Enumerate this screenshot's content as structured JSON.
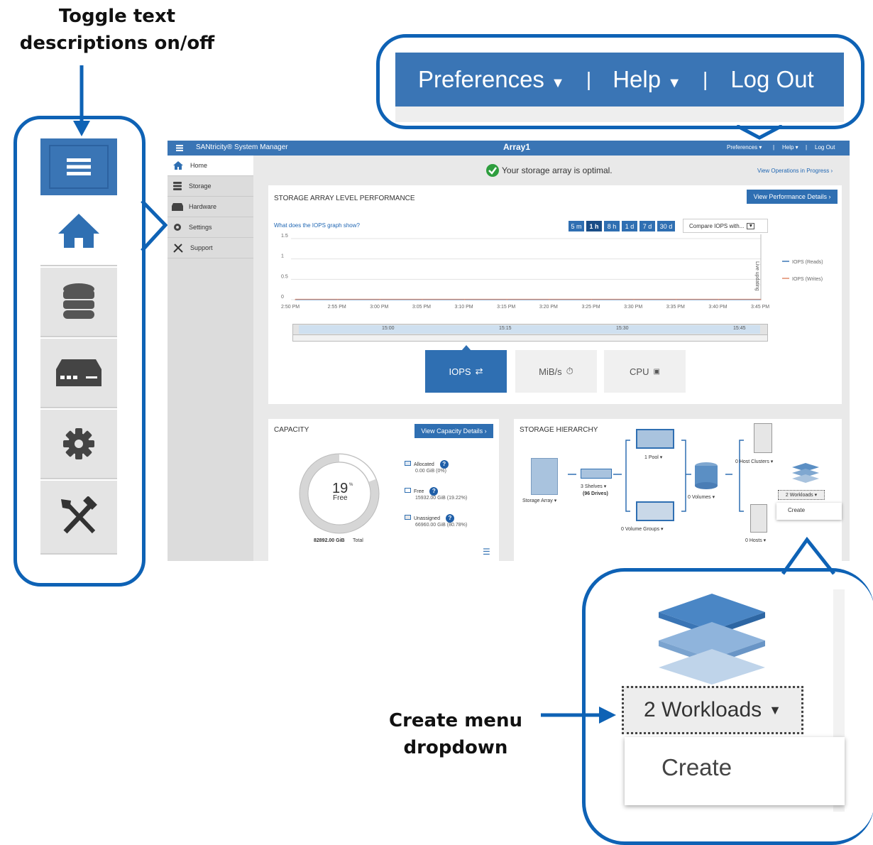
{
  "annotations": {
    "toggle_title_line1": "Toggle text",
    "toggle_title_line2": "descriptions on/off",
    "create_line1": "Create menu",
    "create_line2": "dropdown"
  },
  "zoom_nav": {
    "preferences": "Preferences",
    "sep1": "|",
    "help": "Help",
    "sep2": "|",
    "logout": "Log Out"
  },
  "zoom_workloads": {
    "label": "2 Workloads",
    "create": "Create"
  },
  "app": {
    "brand": "SANtricity® System Manager",
    "array_name": "Array1",
    "nav": {
      "preferences": "Preferences",
      "help": "Help",
      "logout": "Log Out",
      "sep": "|"
    },
    "sidebar": [
      {
        "label": "Home",
        "icon": "home-icon"
      },
      {
        "label": "Storage",
        "icon": "storage-icon"
      },
      {
        "label": "Hardware",
        "icon": "hardware-icon"
      },
      {
        "label": "Settings",
        "icon": "gear-icon"
      },
      {
        "label": "Support",
        "icon": "tools-icon"
      }
    ],
    "status": "Your storage array is optimal.",
    "ops_link": "View Operations in Progress ›",
    "performance": {
      "title": "STORAGE ARRAY LEVEL PERFORMANCE",
      "details_button": "View Performance Details ›",
      "help_link": "What does the IOPS graph show?",
      "ranges": [
        "5 m",
        "1 h",
        "8 h",
        "1 d",
        "7 d",
        "30 d"
      ],
      "compare": "Compare IOPS with...",
      "live": "Live updating",
      "slider_labels": [
        "15:00",
        "15:15",
        "15:30",
        "15:45"
      ],
      "metrics": [
        "IOPS",
        "MiB/s",
        "CPU"
      ]
    },
    "capacity": {
      "title": "CAPACITY",
      "details_button": "View Capacity Details ›",
      "percent": "19",
      "percent_sign": "%",
      "free_label": "Free",
      "total_value": "82892.00 GiB",
      "total_label": "Total",
      "legend": [
        {
          "label": "Allocated",
          "value": "0.00 GiB (0%)"
        },
        {
          "label": "Free",
          "value": "15932.00 GiB (19.22%)"
        },
        {
          "label": "Unassigned",
          "value": "66960.00 GiB (80.78%)"
        }
      ]
    },
    "hierarchy": {
      "title": "STORAGE HIERARCHY",
      "storage_array": "Storage Array",
      "shelves": "3 Shelves",
      "drives": "(96 Drives)",
      "pool": "1 Pool",
      "volume_groups": "0 Volume Groups",
      "volumes": "0 Volumes",
      "host_clusters": "0 Host Clusters",
      "workloads": "2 Workloads",
      "create": "Create",
      "hosts": "0 Hosts"
    }
  },
  "chart_data": {
    "type": "line",
    "title": "",
    "x": [
      "2:50 PM",
      "2:55 PM",
      "3:00 PM",
      "3:05 PM",
      "3:10 PM",
      "3:15 PM",
      "3:20 PM",
      "3:25 PM",
      "3:30 PM",
      "3:35 PM",
      "3:40 PM",
      "3:45 PM"
    ],
    "series": [
      {
        "name": "IOPS (Reads)",
        "values": [
          0,
          0,
          0,
          0,
          0,
          0,
          0,
          0,
          0,
          0,
          0,
          0
        ],
        "color": "#3a75b5"
      },
      {
        "name": "IOPS (Writes)",
        "values": [
          0,
          0,
          0,
          0,
          0,
          0,
          0,
          0,
          0,
          0,
          0,
          0
        ],
        "color": "#e08a6a"
      }
    ],
    "yticks": [
      "1.5",
      "1",
      "0.5",
      "0"
    ],
    "ylim": [
      0,
      1.5
    ],
    "legend": "right",
    "grid": true
  },
  "colors": {
    "brand_blue": "#3a75b5",
    "callout_blue": "#0e62b5",
    "ok_green": "#2e9e3e"
  }
}
